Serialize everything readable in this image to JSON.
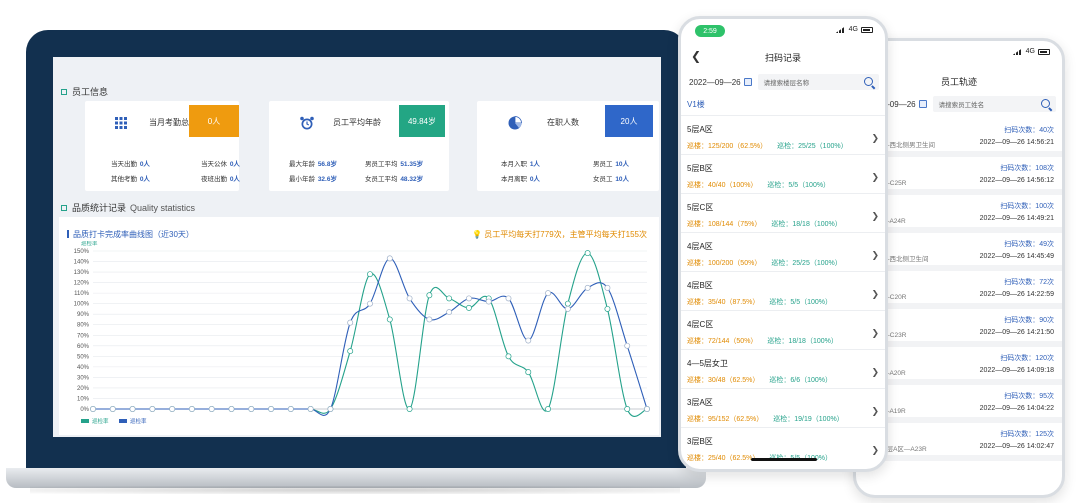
{
  "dashboard": {
    "staff_section": "员工信息",
    "cards": [
      {
        "label": "当月考勤总数",
        "value": "0人",
        "badge_color": "#ef9b0f",
        "icon": "grid-icon",
        "stats": [
          {
            "label": "当天出勤",
            "value": "0人"
          },
          {
            "label": "当天公休",
            "value": "0人"
          },
          {
            "label": "其他考勤",
            "value": "0人"
          },
          {
            "label": "夜班出勤",
            "value": "0人"
          }
        ]
      },
      {
        "label": "员工平均年龄",
        "value": "49.84岁",
        "badge_color": "#23a684",
        "icon": "alarm-clock-icon",
        "stats": [
          {
            "label": "最大年龄",
            "value": "56.8岁"
          },
          {
            "label": "男员工平均",
            "value": "51.35岁"
          },
          {
            "label": "最小年龄",
            "value": "32.6岁"
          },
          {
            "label": "女员工平均",
            "value": "48.32岁"
          }
        ]
      },
      {
        "label": "在职人数",
        "value": "20人",
        "badge_color": "#2f67c9",
        "icon": "pie-chart-icon",
        "stats": [
          {
            "label": "本月入职",
            "value": "1人"
          },
          {
            "label": "男员工",
            "value": "10人"
          },
          {
            "label": "本月离职",
            "value": "0人"
          },
          {
            "label": "女员工",
            "value": "10人"
          }
        ]
      }
    ],
    "quality_section": "品质统计记录",
    "quality_section_en": "Quality statistics",
    "chart_title": "品质打卡完成率曲线图（近30天）",
    "chart_note": "员工平均每天打779次，主管平均每天打155次",
    "accent_green": "#25a28b",
    "accent_blue": "#2f5fb8"
  },
  "chart_data": {
    "type": "line",
    "title": "品质打卡完成率曲线图（近30天）",
    "ylim": [
      0,
      150
    ],
    "y_ticks": [
      "0%",
      "10%",
      "20%",
      "30%",
      "40%",
      "50%",
      "60%",
      "70%",
      "80%",
      "90%",
      "100%",
      "110%",
      "120%",
      "130%",
      "140%",
      "150%"
    ],
    "grid": true,
    "legend_placement": "bottom-left",
    "series": [
      {
        "name": "巡检率",
        "color": "#25a28b",
        "values": [
          0,
          0,
          0,
          0,
          0,
          0,
          0,
          0,
          0,
          0,
          0,
          0,
          0,
          55,
          128,
          85,
          0,
          108,
          105,
          96,
          105,
          50,
          35,
          0,
          100,
          148,
          95,
          0,
          0
        ]
      },
      {
        "name": "巡检率",
        "color": "#2f5fb8",
        "values": [
          0,
          0,
          0,
          0,
          0,
          0,
          0,
          0,
          0,
          0,
          0,
          0,
          0,
          82,
          100,
          143,
          105,
          85,
          92,
          105,
          102,
          105,
          65,
          110,
          95,
          115,
          115,
          60,
          0
        ]
      }
    ]
  },
  "phone_scan": {
    "time": "2:59",
    "signal_text": "4G",
    "title": "扫码记录",
    "date": "2022—09—26",
    "search_placeholder": "请搜索楼层名称",
    "building": "V1楼",
    "areas": [
      {
        "name": "5层A区",
        "floor": "巡楼：125/200（62.5%）",
        "check": "巡检：25/25（100%）"
      },
      {
        "name": "5层B区",
        "floor": "巡楼：40/40（100%）",
        "check": "巡检：5/5（100%）"
      },
      {
        "name": "5层C区",
        "floor": "巡楼：108/144（75%）",
        "check": "巡检：18/18（100%）"
      },
      {
        "name": "4层A区",
        "floor": "巡楼：100/200（50%）",
        "check": "巡检：25/25（100%）"
      },
      {
        "name": "4层B区",
        "floor": "巡楼：35/40（87.5%）",
        "check": "巡检：5/5（100%）"
      },
      {
        "name": "4层C区",
        "floor": "巡楼：72/144（50%）",
        "check": "巡检：18/18（100%）"
      },
      {
        "name": "4—5层女卫",
        "floor": "巡楼：30/48（62.5%）",
        "check": "巡检：6/6（100%）"
      },
      {
        "name": "3层A区",
        "floor": "巡楼：95/152（62.5%）",
        "check": "巡检：19/19（100%）"
      },
      {
        "name": "3层B区",
        "floor": "巡楼：25/40（62.5%）",
        "check": "巡检：5/5（100%）"
      }
    ]
  },
  "phone_track": {
    "signal_text": "4G",
    "title": "员工轨迹",
    "date": "2022—09—26",
    "search_placeholder": "请搜索员工姓名",
    "records": [
      {
        "count": "扫码次数：40次",
        "location": "5层B区—西北侧男卫生间",
        "time": "2022—09—26 14:56:21"
      },
      {
        "count": "扫码次数：108次",
        "location": "5层C区—C25R",
        "time": "2022—09—26 14:56:12"
      },
      {
        "count": "扫码次数：100次",
        "location": "4层A区—A24R",
        "time": "2022—09—26 14:49:21"
      },
      {
        "count": "扫码次数：49次",
        "location": "5层A区—西北侧卫生间",
        "time": "2022—09—26 14:45:49"
      },
      {
        "count": "扫码次数：72次",
        "location": "4层C区—C20R",
        "time": "2022—09—26 14:22:59"
      },
      {
        "count": "扫码次数：90次",
        "location": "3层C区—C23R",
        "time": "2022—09—26 14:21:50"
      },
      {
        "count": "扫码次数：120次",
        "location": "3层A区—A20R",
        "time": "2022—09—26 14:09:18"
      },
      {
        "count": "扫码次数：95次",
        "location": "3层A区—A19R",
        "time": "2022—09—26 14:04:22"
      },
      {
        "count": "扫码次数：125次",
        "location": "V1楼—5层A区—A23R",
        "time": "2022—09—26 14:02:47"
      }
    ]
  }
}
